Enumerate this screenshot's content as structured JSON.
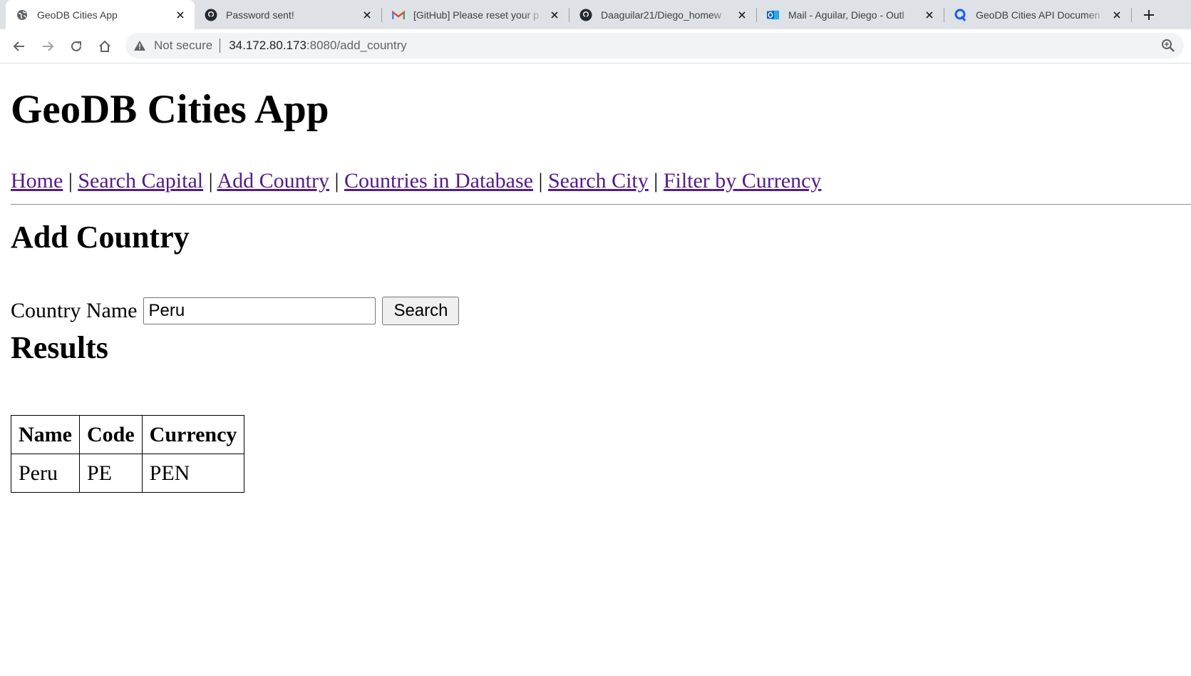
{
  "browser": {
    "tabs": [
      {
        "title": "GeoDB Cities App",
        "icon": "globe-icon",
        "active": true
      },
      {
        "title": "Password sent!",
        "icon": "github-icon",
        "active": false
      },
      {
        "title": "[GitHub] Please reset your p",
        "icon": "gmail-icon",
        "active": false
      },
      {
        "title": "Daaguilar21/Diego_homew",
        "icon": "github-icon",
        "active": false
      },
      {
        "title": "Mail - Aguilar, Diego - Outl",
        "icon": "outlook-icon",
        "active": false
      },
      {
        "title": "GeoDB Cities API Documen",
        "icon": "rapidapi-icon",
        "active": false
      }
    ],
    "address": {
      "security_label": "Not secure",
      "host": "34.172.80.173",
      "path": ":8080/add_country"
    },
    "colors": {
      "tabstrip": "#dee1e6",
      "omnibox": "#f1f3f4",
      "link": "#551a8b"
    }
  },
  "page": {
    "title": "GeoDB Cities App",
    "nav": [
      {
        "label": "Home"
      },
      {
        "label": "Search Capital"
      },
      {
        "label": "Add Country"
      },
      {
        "label": "Countries in Database"
      },
      {
        "label": "Search City"
      },
      {
        "label": "Filter by Currency"
      }
    ],
    "nav_separator": "|",
    "section_title": "Add Country",
    "form": {
      "label": "Country Name",
      "input_value": "Peru",
      "button_label": "Search"
    },
    "results_title": "Results",
    "table": {
      "headers": [
        "Name",
        "Code",
        "Currency"
      ],
      "rows": [
        [
          "Peru",
          "PE",
          "PEN"
        ]
      ]
    }
  }
}
